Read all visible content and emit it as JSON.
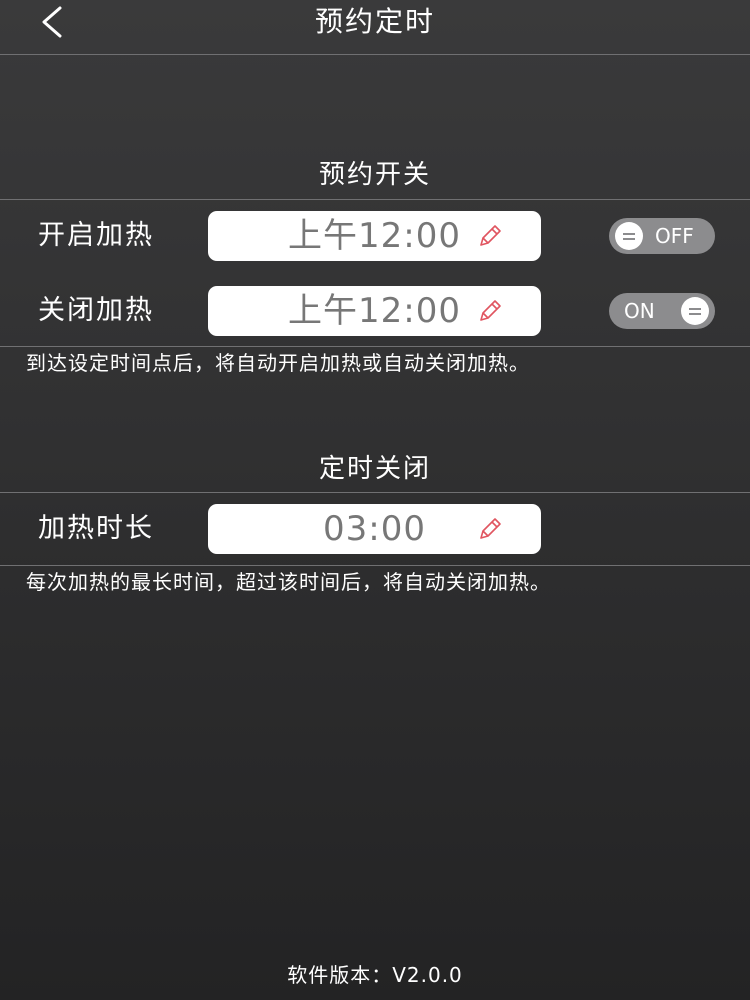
{
  "header": {
    "title": "预约定时",
    "back_icon": "chevron-left-icon"
  },
  "schedule": {
    "title": "预约开关",
    "rows": [
      {
        "label": "开启加热",
        "time": "上午12:00",
        "toggle": "OFF"
      },
      {
        "label": "关闭加热",
        "time": "上午12:00",
        "toggle": "ON"
      }
    ],
    "note": "到达设定时间点后，将自动开启加热或自动关闭加热。"
  },
  "timer": {
    "title": "定时关闭",
    "label": "加热时长",
    "time": "03:00",
    "note": "每次加热的最长时间，超过该时间后，将自动关闭加热。"
  },
  "footer": {
    "version": "软件版本：V2.0.0"
  },
  "colors": {
    "background": "#333334",
    "toggle_track": "#8c8c8e",
    "pencil": "#e05560",
    "time_text": "#777777"
  }
}
